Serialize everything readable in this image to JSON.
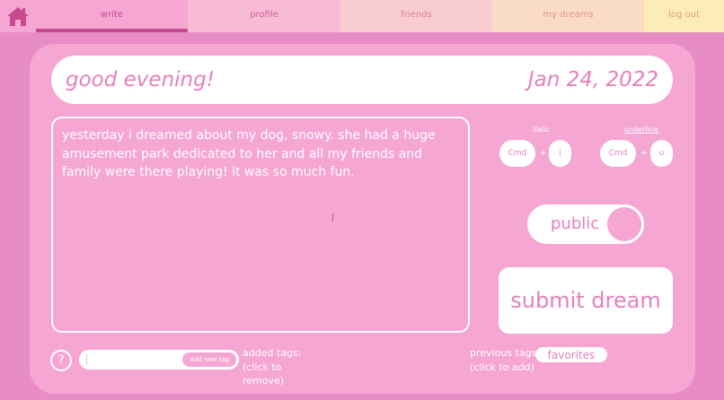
{
  "nav": {
    "tabs": [
      "write",
      "profile",
      "friends",
      "my dreams",
      "log out"
    ]
  },
  "header": {
    "greeting": "good evening!",
    "date": "Jan 24, 2022"
  },
  "entry": {
    "text": "yesterday i dreamed about my dog, snowy. she had a huge amusement park dedicated to her and all my friends and family were there playing! it was so much fun."
  },
  "formatting": {
    "italic_label": "italic",
    "underline_label": "underline",
    "key_cmd": "Cmd",
    "plus": "+",
    "italic_key": "i",
    "underline_key": "u"
  },
  "visibility": {
    "label": "public"
  },
  "submit": {
    "label": "submit dream"
  },
  "tags": {
    "help": "?",
    "input_value": "",
    "add_label": "add new tag",
    "added_note": "added tags:\n(click to\nremove)",
    "previous_note": "previous tags:\n(click to add)",
    "previous": [
      "favorites"
    ]
  },
  "colors": {
    "background": "#e88cc6",
    "card": "#f5a6d3",
    "accent_text": "#e481bd",
    "active_tab": "#c8498f"
  }
}
